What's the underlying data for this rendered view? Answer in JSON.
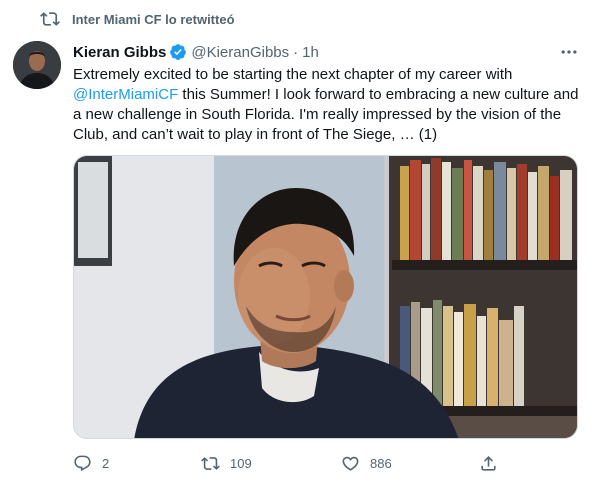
{
  "retweet_label": "Inter Miami CF lo retwitteó",
  "author": {
    "name": "Kieran Gibbs",
    "handle": "@KieranGibbs",
    "time": "1h",
    "separator": "·"
  },
  "text": {
    "line1": "Extremely excited to be starting the next chapter of my career with",
    "mention": "@InterMiamiCF",
    "line2_rest": " this Summer! I look forward to embracing a new culture and",
    "line3": "a new challenge in South Florida. I'm really impressed by the vision of the",
    "line4": "Club, and can’t wait to play in front of The Siege, … (1)"
  },
  "actions": {
    "replies": "2",
    "retweets": "109",
    "likes": "886"
  },
  "icons": {
    "retweet": "retweet-icon",
    "verified": "verified-badge-icon",
    "more": "more-options-icon",
    "reply": "reply-icon",
    "like": "heart-icon",
    "share": "share-icon"
  },
  "colors": {
    "accent": "#1d9bf0",
    "muted": "#536471",
    "text": "#0f1419"
  }
}
